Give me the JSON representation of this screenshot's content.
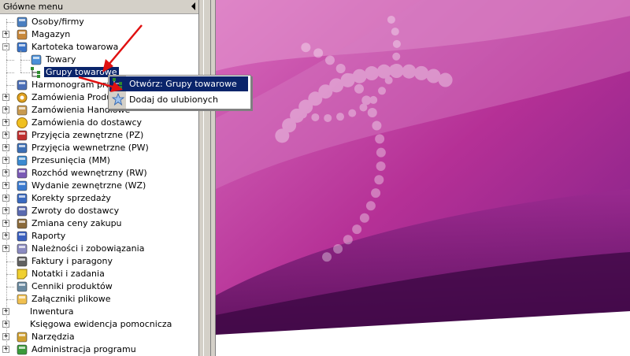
{
  "panel": {
    "title": "Główne menu"
  },
  "tree": [
    {
      "label": "Osoby/firmy",
      "icon": "address-card-icon",
      "expandable": false
    },
    {
      "label": "Magazyn",
      "icon": "box-icon",
      "expandable": true,
      "expanded": false
    },
    {
      "label": "Kartoteka towarowa",
      "icon": "catalog-icon",
      "expandable": true,
      "expanded": true
    },
    {
      "label": "Towary",
      "icon": "product-icon",
      "child": true
    },
    {
      "label": "Grupy towarowe",
      "icon": "groups-icon",
      "child": true,
      "selected": true
    },
    {
      "label": "Harmonogram pracy",
      "icon": "schedule-icon",
      "expandable": false
    },
    {
      "label": "Zamówienia Produkcji",
      "icon": "gear-icon",
      "expandable": true
    },
    {
      "label": "Zamówienia Handlowe",
      "icon": "handshake-icon",
      "expandable": true
    },
    {
      "label": "Zamówienia do dostawcy",
      "icon": "supplier-order-icon",
      "expandable": true
    },
    {
      "label": "Przyjęcia zewnętrzne (PZ)",
      "icon": "truck-icon",
      "expandable": true
    },
    {
      "label": "Przyjęcia wewnetrzne (PW)",
      "icon": "internal-receipt-icon",
      "expandable": true
    },
    {
      "label": "Przesunięcia (MM)",
      "icon": "transfer-icon",
      "expandable": true
    },
    {
      "label": "Rozchód wewnętrzny (RW)",
      "icon": "internal-issue-icon",
      "expandable": true
    },
    {
      "label": "Wydanie zewnętrzne (WZ)",
      "icon": "external-issue-icon",
      "expandable": true
    },
    {
      "label": "Korekty sprzedaży",
      "icon": "sales-correction-icon",
      "expandable": true
    },
    {
      "label": "Zwroty do dostawcy",
      "icon": "return-icon",
      "expandable": true
    },
    {
      "label": "Zmiana ceny zakupu",
      "icon": "hammer-icon",
      "expandable": true
    },
    {
      "label": "Raporty",
      "icon": "report-chart-icon",
      "expandable": true
    },
    {
      "label": "Należności i zobowiązania",
      "icon": "bank-icon",
      "expandable": true
    },
    {
      "label": "Faktury i paragony",
      "icon": "invoice-icon",
      "expandable": false
    },
    {
      "label": "Notatki i zadania",
      "icon": "note-icon",
      "expandable": false
    },
    {
      "label": "Cenniki produktów",
      "icon": "price-list-icon",
      "expandable": false
    },
    {
      "label": "Załączniki plikowe",
      "icon": "attachment-icon",
      "expandable": false
    },
    {
      "label": "Inwentura",
      "icon": "none",
      "expandable": true
    },
    {
      "label": "Księgowa ewidencja pomocnicza",
      "icon": "none",
      "expandable": true
    },
    {
      "label": "Narzędzia",
      "icon": "wrench-icon",
      "expandable": true
    },
    {
      "label": "Administracja programu",
      "icon": "admin-icon",
      "expandable": true
    }
  ],
  "context_menu": [
    {
      "label": "Otwórz: Grupy towarowe",
      "icon": "groups-icon",
      "active": true
    },
    {
      "label": "Dodaj do ulubionych",
      "icon": "star-icon",
      "active": false
    }
  ],
  "colors": {
    "accent": "#0a246a",
    "arrow": "#e01010",
    "bg_magenta": "#c0309a",
    "bg_dark": "#4a0a50"
  }
}
